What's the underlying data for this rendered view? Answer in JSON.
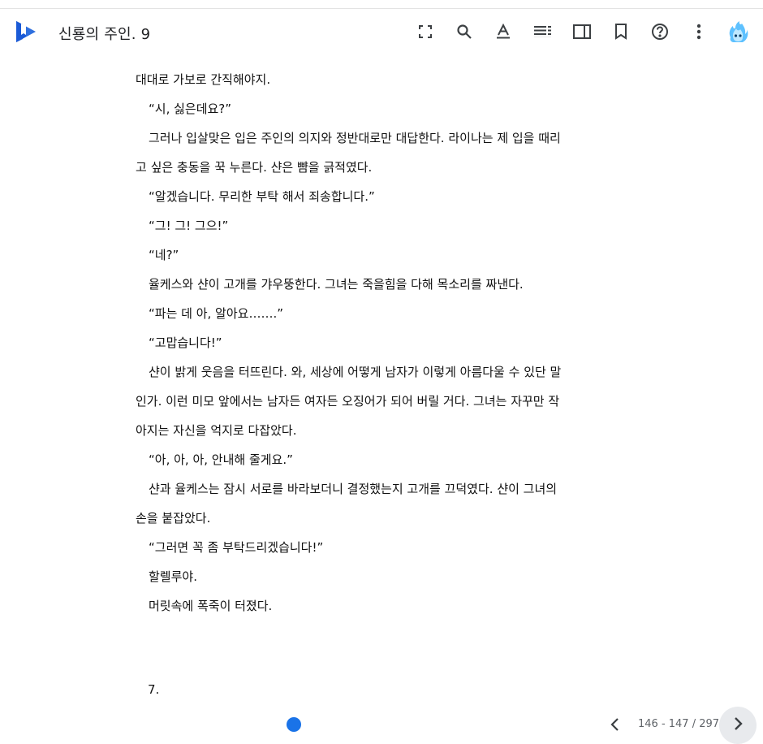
{
  "header": {
    "book_title": "신룡의 주인. 9"
  },
  "toolbar": {
    "icons": [
      "fullscreen-icon",
      "search-icon",
      "text-format-icon",
      "contents-icon",
      "side-panel-icon",
      "bookmark-icon",
      "help-icon",
      "more-icon",
      "avatar"
    ],
    "accent": "#1a73e8"
  },
  "content": {
    "lines": [
      "대대로 가보로 간직해야지.",
      "“시, 싫은데요?”",
      "그러나 입살맞은 입은 주인의 의지와 정반대로만 대답한다. 라이나는 제 입을 때리",
      "고 싶은 충동을 꾹 누른다. 샨은 뺨을 긁적였다.",
      "“알겠습니다. 무리한 부탁 해서 죄송합니다.”",
      "“그! 그! 그으!”",
      "“네?”",
      "율케스와 샨이 고개를 갸우뚱한다. 그녀는 죽을힘을 다해 목소리를 짜낸다.",
      "“파는 데 아, 알아요…….”",
      "“고맙습니다!”",
      "샨이 밝게 웃음을 터뜨린다. 와, 세상에 어떻게 남자가 이렇게 아름다울 수 있단 말",
      "인가. 이런 미모 앞에서는 남자든 여자든 오징어가 되어 버릴 거다. 그녀는 자꾸만 작",
      "아지는 자신을 억지로 다잡았다.",
      "“아, 아, 아, 안내해 줄게요.”",
      "샨과 율케스는 잠시 서로를 바라보더니 결정했는지 고개를 끄덕였다. 샨이 그녀의",
      "손을 붙잡았다.",
      "“그러면 꼭 좀 부탁드리겠습니다!”",
      "할렐루야.",
      "머릿속에 폭죽이 터졌다."
    ],
    "page_heading": "7."
  },
  "footer": {
    "page_counter": "146 - 147 / 297"
  }
}
